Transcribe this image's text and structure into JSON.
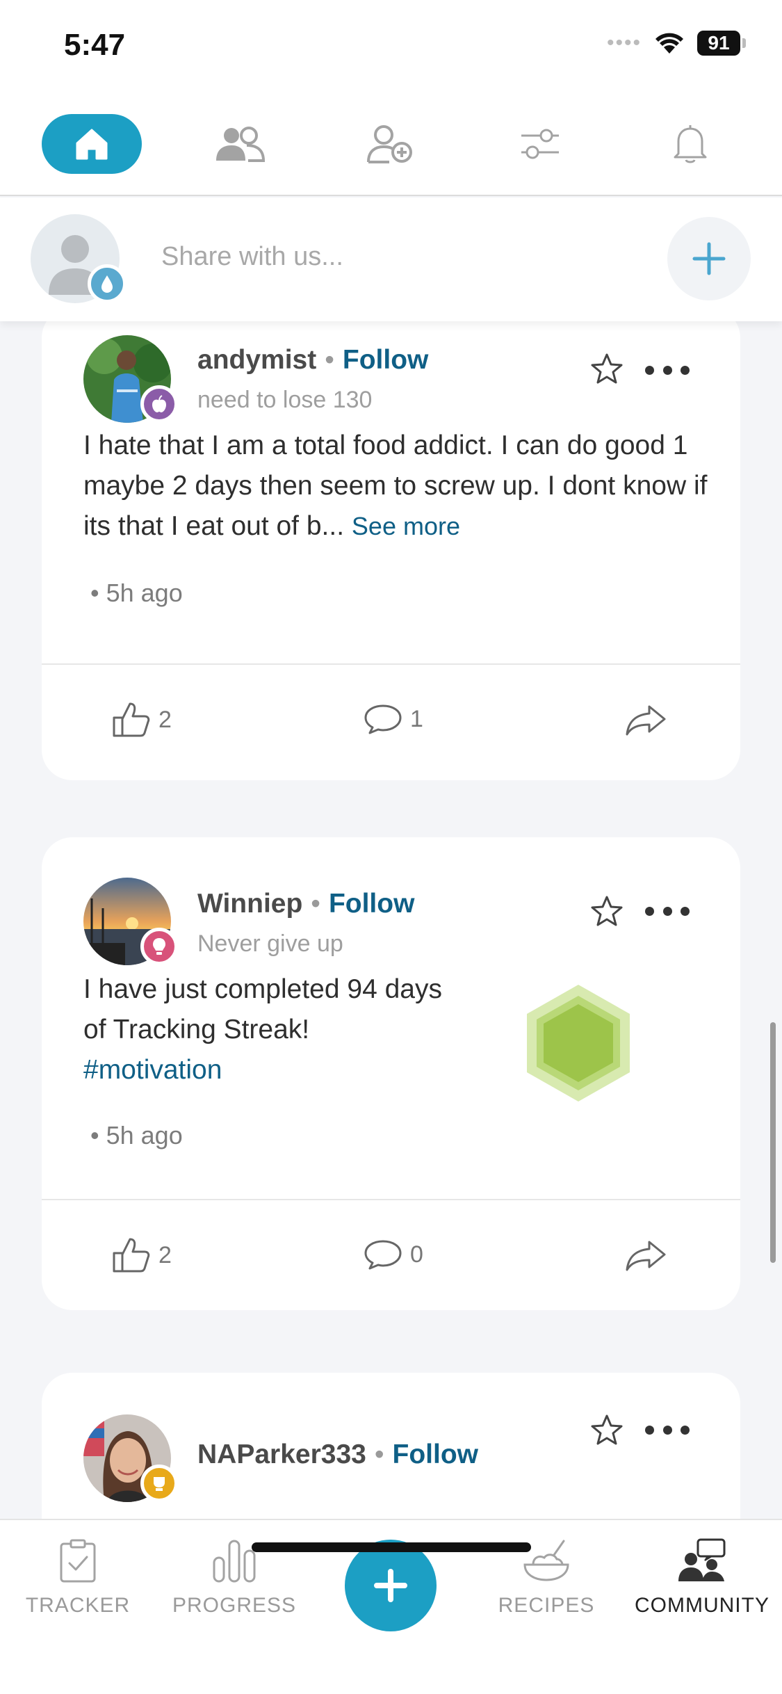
{
  "status_bar": {
    "time": "5:47",
    "battery": "91"
  },
  "share": {
    "placeholder": "Share with us..."
  },
  "posts": [
    {
      "username": "andymist",
      "follow_label": "Follow",
      "subtitle": "need to lose 130",
      "body": "I hate that I am a total food addict. I can do good 1 maybe 2 days then seem to screw up. I dont know if its that I eat out of b...",
      "see_more": "See more",
      "time": "5h ago",
      "likes": "2",
      "comments": "1"
    },
    {
      "username": "Winniep",
      "follow_label": "Follow",
      "subtitle": "Never give up",
      "body": "I have just completed 94 days of Tracking Streak!",
      "hashtag": "#motivation",
      "time": "5h ago",
      "likes": "2",
      "comments": "0"
    },
    {
      "username": "NAParker333",
      "follow_label": "Follow"
    }
  ],
  "tabs": [
    {
      "label": "TRACKER",
      "icon": "clipboard-check-icon"
    },
    {
      "label": "PROGRESS",
      "icon": "bar-chart-icon"
    },
    {
      "label": "RECIPES",
      "icon": "bowl-icon"
    },
    {
      "label": "COMMUNITY",
      "icon": "community-icon"
    }
  ],
  "colors": {
    "accent": "#1c9fc4",
    "link": "#0f5f86",
    "streak_badge": "#9dc44a"
  }
}
